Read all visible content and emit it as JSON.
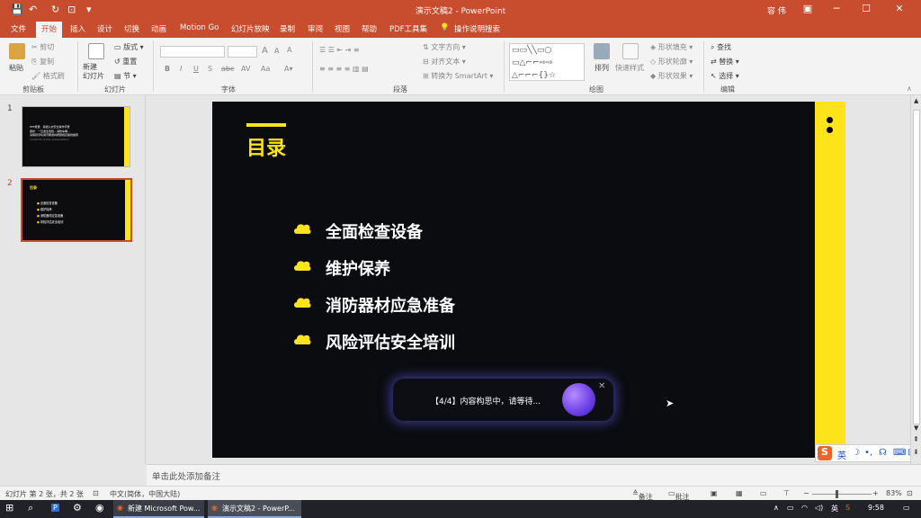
{
  "window": {
    "title": "演示文稿2 - PowerPoint",
    "user": "容 伟"
  },
  "tabs": [
    "文件",
    "开始",
    "插入",
    "设计",
    "切换",
    "动画",
    "Motion Go",
    "幻灯片放映",
    "录制",
    "审阅",
    "视图",
    "帮助",
    "PDF工具集",
    "操作说明搜索"
  ],
  "ribbon": {
    "clipboard": {
      "paste": "粘贴",
      "cut": "剪切",
      "copy": "复制",
      "format_painter": "格式刷",
      "label": "剪贴板"
    },
    "slides": {
      "new_slide": "新建\n幻灯片",
      "layout": "版式",
      "reset": "重置",
      "section": "节",
      "label": "幻灯片"
    },
    "font": {
      "label": "字体",
      "bold": "B",
      "italic": "I",
      "underline": "U",
      "strike": "S",
      "shadow": "abc",
      "grow": "A",
      "shrink": "A",
      "clear": "A"
    },
    "paragraph": {
      "label": "段落",
      "text_direction": "文字方向",
      "align_text": "对齐文本",
      "smartart": "转换为 SmartArt"
    },
    "drawing": {
      "label": "绘图",
      "arrange": "排列",
      "quick_styles": "快速样式",
      "fill": "形状填充",
      "outline": "形状轮廓",
      "effects": "形状效果"
    },
    "editing": {
      "label": "编辑",
      "find": "查找",
      "replace": "替换",
      "select": "选择"
    }
  },
  "thumbnails": [
    {
      "num": "1",
      "line1": "PPT能量：基础火灾安全操作手册",
      "line2": "保护：一旦发生危险…消防车辆…",
      "line3": "请保持手机通讯畅通并按照规定路线撤离",
      "line4": "Contents of this presentation"
    },
    {
      "num": "2",
      "title": "目录",
      "items": [
        "全面检查设备",
        "维护保养",
        "消防器材应急准备",
        "风险评估安全培训"
      ]
    }
  ],
  "slide": {
    "title": "目录",
    "items": [
      "全面检查设备",
      "维护保养",
      "消防器材应急准备",
      "风险评估安全培训"
    ],
    "colors": {
      "accent": "#fde31a",
      "background": "#0b0c10"
    }
  },
  "toast": {
    "message": "【4/4】内容构思中，请等待..."
  },
  "notes": {
    "placeholder": "单击此处添加备注"
  },
  "status": {
    "slide_count": "幻灯片 第 2 张，共 2 张",
    "language": "中文(简体，中国大陆)",
    "notes": "备注",
    "comments": "批注",
    "zoom": "83%"
  },
  "ime": {
    "lang": "英"
  },
  "taskbar": {
    "apps": [
      "新建 Microsoft Pow...",
      "演示文稿2 - PowerP..."
    ],
    "lang": "英",
    "time": "9:58"
  }
}
